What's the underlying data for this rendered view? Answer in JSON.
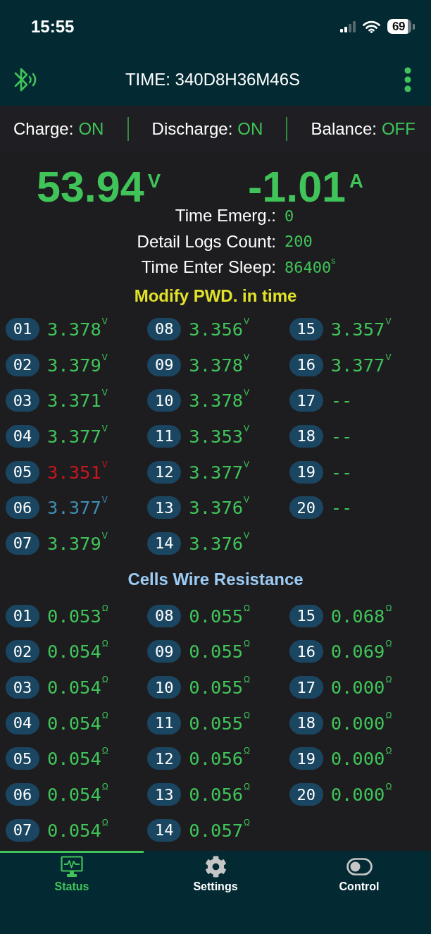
{
  "status_bar": {
    "time": "15:55",
    "battery": "69"
  },
  "header": {
    "title": "TIME: 340D8H36M46S"
  },
  "switches": [
    {
      "label": "Charge:",
      "value": "ON"
    },
    {
      "label": "Discharge:",
      "value": "ON"
    },
    {
      "label": "Balance:",
      "value": "OFF"
    }
  ],
  "readings": [
    {
      "value": "53.94$^{V}$"
    },
    {
      "value": "-1.01$^{A}$"
    }
  ],
  "settings": [
    {
      "label": "Time Emerg.:",
      "value": "0"
    },
    {
      "label": "Detail Logs Count:",
      "value": "200"
    },
    {
      "label": "Time Enter Sleep:",
      "value": "86400$^{s}$"
    }
  ],
  "notice": "Modify PWD. in time",
  "cell_voltages": [
    {
      "number": "01",
      "value": "3.378$^{V}$",
      "color": "#40c459"
    },
    {
      "number": "02",
      "value": "3.379$^{V}$",
      "color": "#40c459"
    },
    {
      "number": "03",
      "value": "3.371$^{V}$",
      "color": "#40c459"
    },
    {
      "number": "04",
      "value": "3.377$^{V}$",
      "color": "#40c459"
    },
    {
      "number": "05",
      "value": "3.351$^{V}$",
      "color": "#c8161d"
    },
    {
      "number": "06",
      "value": "3.377$^{V}$",
      "color": "#3f8db2"
    },
    {
      "number": "07",
      "value": "3.379$^{V}$",
      "color": "#40c459"
    },
    {
      "number": "08",
      "value": "3.356$^{V}$",
      "color": "#40c459"
    },
    {
      "number": "09",
      "value": "3.378$^{V}$",
      "color": "#40c459"
    },
    {
      "number": "10",
      "value": "3.378$^{V}$",
      "color": "#40c459"
    },
    {
      "number": "11",
      "value": "3.353$^{V}$",
      "color": "#40c459"
    },
    {
      "number": "12",
      "value": "3.377$^{V}$",
      "color": "#40c459"
    },
    {
      "number": "13",
      "value": "3.376$^{V}$",
      "color": "#40c459"
    },
    {
      "number": "14",
      "value": "3.376$^{V}$",
      "color": "#40c459"
    },
    {
      "number": "15",
      "value": "3.357$^{V}$",
      "color": "#40c459"
    },
    {
      "number": "16",
      "value": "3.377$^{V}$",
      "color": "#40c459"
    },
    {
      "number": "17",
      "value": "--",
      "color": "#40c459"
    },
    {
      "number": "18",
      "value": "--",
      "color": "#40c459"
    },
    {
      "number": "19",
      "value": "--",
      "color": "#40c459"
    },
    {
      "number": "20",
      "value": "--",
      "color": "#40c459"
    }
  ],
  "wire_resistance": {
    "title": "Cells Wire Resistance",
    "cells": [
      {
        "number": "01",
        "value": "0.053$^{Ω}$"
      },
      {
        "number": "02",
        "value": "0.054$^{Ω}$"
      },
      {
        "number": "03",
        "value": "0.054$^{Ω}$"
      },
      {
        "number": "04",
        "value": "0.054$^{Ω}$"
      },
      {
        "number": "05",
        "value": "0.054$^{Ω}$"
      },
      {
        "number": "06",
        "value": "0.054$^{Ω}$"
      },
      {
        "number": "07",
        "value": "0.054$^{Ω}$"
      },
      {
        "number": "08",
        "value": "0.055$^{Ω}$"
      },
      {
        "number": "09",
        "value": "0.055$^{Ω}$"
      },
      {
        "number": "10",
        "value": "0.055$^{Ω}$"
      },
      {
        "number": "11",
        "value": "0.055$^{Ω}$"
      },
      {
        "number": "12",
        "value": "0.056$^{Ω}$"
      },
      {
        "number": "13",
        "value": "0.056$^{Ω}$"
      },
      {
        "number": "14",
        "value": "0.057$^{Ω}$"
      },
      {
        "number": "15",
        "value": "0.068$^{Ω}$"
      },
      {
        "number": "16",
        "value": "0.069$^{Ω}$"
      },
      {
        "number": "17",
        "value": "0.000$^{Ω}$"
      },
      {
        "number": "18",
        "value": "0.000$^{Ω}$"
      },
      {
        "number": "19",
        "value": "0.000$^{Ω}$"
      },
      {
        "number": "20",
        "value": "0.000$^{Ω}$"
      }
    ]
  },
  "tabs": [
    {
      "label": "Status",
      "selected": true
    },
    {
      "label": "Settings",
      "selected": false
    },
    {
      "label": "Control",
      "selected": false
    }
  ]
}
